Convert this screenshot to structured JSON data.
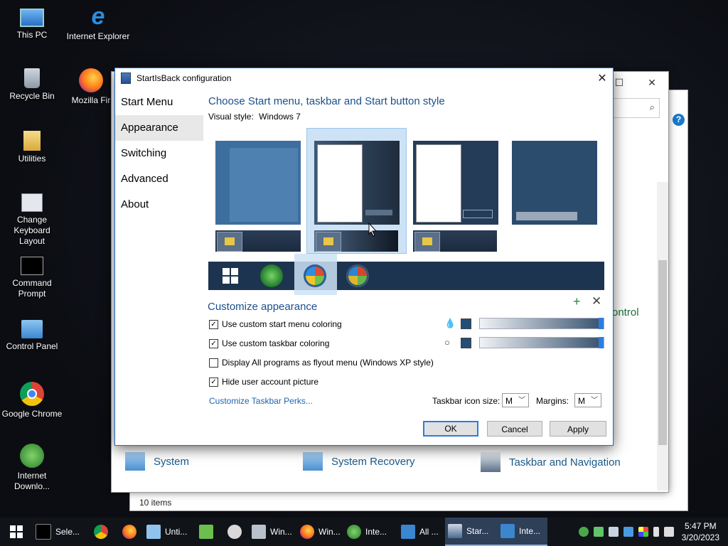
{
  "desktop": {
    "icons": [
      {
        "label": "This PC"
      },
      {
        "label": "Internet Explorer"
      },
      {
        "label": "Recycle Bin"
      },
      {
        "label": "Mozilla Fir"
      },
      {
        "label": "Utilities"
      },
      {
        "label": "Change Keyboard Layout"
      },
      {
        "label": "Command Prompt"
      },
      {
        "label": "Control Panel"
      },
      {
        "label": "Google Chrome"
      },
      {
        "label": "Internet Downlo..."
      }
    ]
  },
  "background_window": {
    "rows": [
      {
        "label": "System"
      },
      {
        "label": "System Recovery"
      },
      {
        "label": "Taskbar and Navigation"
      }
    ],
    "status": "10 items",
    "partial_text": "ontrol",
    "help": "?"
  },
  "dialog": {
    "title": "StartIsBack configuration",
    "close": "✕",
    "nav": [
      {
        "label": "Start Menu"
      },
      {
        "label": "Appearance"
      },
      {
        "label": "Switching"
      },
      {
        "label": "Advanced"
      },
      {
        "label": "About"
      }
    ],
    "selected_nav": "Appearance",
    "heading": "Choose Start menu, taskbar and Start button style",
    "visual_style_label": "Visual style:",
    "visual_style_value": "Windows 7",
    "customize_heading": "Customize appearance",
    "plus": "+",
    "remove": "✕",
    "checkboxes": [
      {
        "label": "Use custom start menu coloring",
        "checked": true
      },
      {
        "label": "Use custom taskbar coloring",
        "checked": true
      },
      {
        "label": "Display All programs as flyout menu (Windows XP style)",
        "checked": false
      },
      {
        "label": "Hide user account picture",
        "checked": true
      }
    ],
    "checkmark": "✓",
    "start_menu_color": "#234e76",
    "taskbar_color": "#234e76",
    "start_menu_opacity": 1.0,
    "taskbar_opacity": 1.0,
    "link": "Customize Taskbar Perks...",
    "icon_size_label": "Taskbar icon size:",
    "icon_size_value": "M",
    "margins_label": "Margins:",
    "margins_value": "M",
    "ok": "OK",
    "cancel": "Cancel",
    "apply": "Apply"
  },
  "taskbar": {
    "items": [
      {
        "label": "Sele..."
      },
      {
        "label": ""
      },
      {
        "label": ""
      },
      {
        "label": "Unti..."
      },
      {
        "label": ""
      },
      {
        "label": ""
      },
      {
        "label": "Win..."
      },
      {
        "label": "Win..."
      },
      {
        "label": "Inte..."
      },
      {
        "label": "All ..."
      },
      {
        "label": "Star..."
      },
      {
        "label": "Inte..."
      }
    ],
    "time": "5:47 PM",
    "date": "3/20/2023"
  }
}
